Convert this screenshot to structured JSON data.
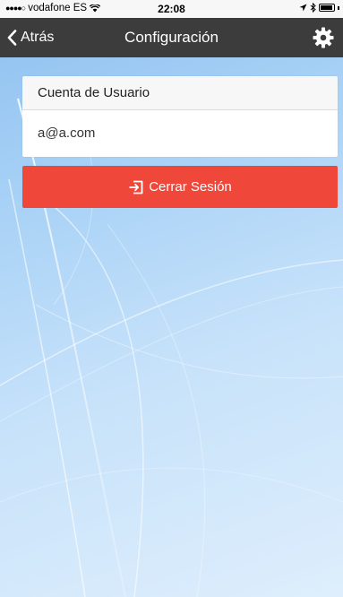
{
  "status_bar": {
    "carrier": "vodafone ES",
    "time": "22:08",
    "battery_level": 0.9
  },
  "nav": {
    "back_label": "Atrás",
    "title": "Configuración",
    "settings_icon": "gear-icon",
    "back_icon": "chevron-left-icon"
  },
  "account": {
    "header": "Cuenta de Usuario",
    "email": "a@a.com"
  },
  "logout": {
    "label": "Cerrar Sesión",
    "icon": "sign-out-icon",
    "color": "#ef473a"
  },
  "colors": {
    "navbar": "#3c3c3c",
    "status_bar": "#f7f7f7",
    "background": "#a9d2f6"
  }
}
